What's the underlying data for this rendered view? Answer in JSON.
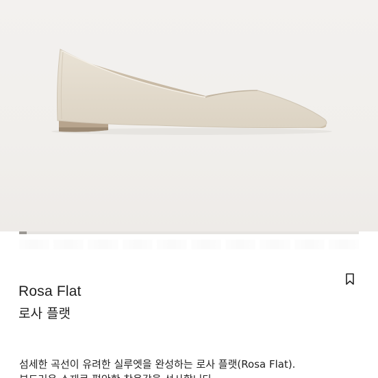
{
  "product": {
    "name_en": "Rosa Flat",
    "name_ko": "로사 플랫",
    "description_line1": "섬세한 곡선이 유려한 실루엣을 완성하는 로사 플랫(Rosa Flat).",
    "description_line2": "부드러운 소재로 편안한 착용감을 선사합니다."
  },
  "gallery": {
    "progress_fraction": 0.022
  },
  "icons": {
    "bookmark": "bookmark-icon"
  },
  "colors": {
    "shoe_body": "#e3dbcb",
    "heel": "#b9a68f",
    "background": "#f2f0ee"
  }
}
